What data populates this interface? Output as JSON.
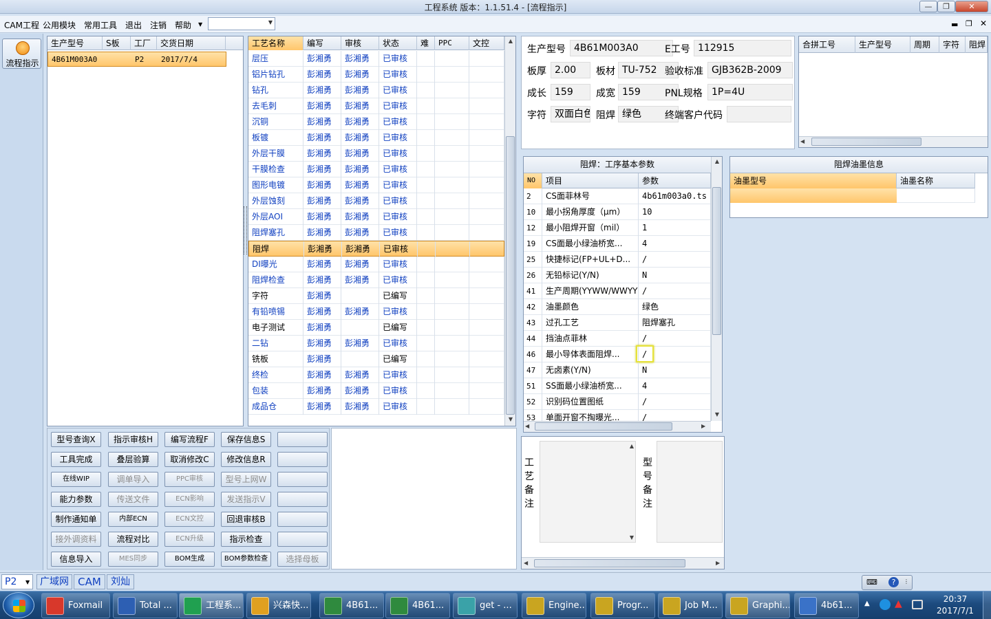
{
  "window": {
    "title": "工程系统   版本：1.1.51.4 - [流程指示]"
  },
  "menu": {
    "items": [
      "CAM工程",
      "公用模块",
      "常用工具",
      "退出",
      "注销",
      "帮助"
    ],
    "combo_value": ""
  },
  "left_strip": {
    "flow_button": "流程指示"
  },
  "orders": {
    "columns": [
      "生产型号",
      "S板",
      "工厂",
      "交货日期"
    ],
    "rows": [
      {
        "model": "4B61M003A0",
        "s": "",
        "factory": "P2",
        "date": "2017/7/4"
      }
    ]
  },
  "process": {
    "columns": [
      "工艺名称",
      "编写",
      "审核",
      "状态",
      "难",
      "PPC",
      "文控"
    ],
    "selected_index": 12,
    "rows": [
      {
        "name": "层压",
        "writer": "彭湘勇",
        "reviewer": "彭湘勇",
        "status": "已审核"
      },
      {
        "name": "铝片钻孔",
        "writer": "彭湘勇",
        "reviewer": "彭湘勇",
        "status": "已审核"
      },
      {
        "name": "钻孔",
        "writer": "彭湘勇",
        "reviewer": "彭湘勇",
        "status": "已审核"
      },
      {
        "name": "去毛刺",
        "writer": "彭湘勇",
        "reviewer": "彭湘勇",
        "status": "已审核"
      },
      {
        "name": "沉铜",
        "writer": "彭湘勇",
        "reviewer": "彭湘勇",
        "status": "已审核"
      },
      {
        "name": "板镀",
        "writer": "彭湘勇",
        "reviewer": "彭湘勇",
        "status": "已审核"
      },
      {
        "name": "外层干膜",
        "writer": "彭湘勇",
        "reviewer": "彭湘勇",
        "status": "已审核"
      },
      {
        "name": "干膜检查",
        "writer": "彭湘勇",
        "reviewer": "彭湘勇",
        "status": "已审核"
      },
      {
        "name": "图形电镀",
        "writer": "彭湘勇",
        "reviewer": "彭湘勇",
        "status": "已审核"
      },
      {
        "name": "外层蚀刻",
        "writer": "彭湘勇",
        "reviewer": "彭湘勇",
        "status": "已审核"
      },
      {
        "name": "外层AOI",
        "writer": "彭湘勇",
        "reviewer": "彭湘勇",
        "status": "已审核"
      },
      {
        "name": "阻焊塞孔",
        "writer": "彭湘勇",
        "reviewer": "彭湘勇",
        "status": "已审核"
      },
      {
        "name": "阻焊",
        "writer": "彭湘勇",
        "reviewer": "彭湘勇",
        "status": "已审核"
      },
      {
        "name": "DI曝光",
        "writer": "彭湘勇",
        "reviewer": "彭湘勇",
        "status": "已审核"
      },
      {
        "name": "阻焊检查",
        "writer": "彭湘勇",
        "reviewer": "彭湘勇",
        "status": "已审核"
      },
      {
        "name": "字符",
        "writer": "彭湘勇",
        "reviewer": "",
        "status": "已编写"
      },
      {
        "name": "有铅喷锡",
        "writer": "彭湘勇",
        "reviewer": "彭湘勇",
        "status": "已审核"
      },
      {
        "name": "电子测试",
        "writer": "彭湘勇",
        "reviewer": "",
        "status": "已编写"
      },
      {
        "name": "二钻",
        "writer": "彭湘勇",
        "reviewer": "彭湘勇",
        "status": "已审核"
      },
      {
        "name": "铣板",
        "writer": "彭湘勇",
        "reviewer": "",
        "status": "已编写"
      },
      {
        "name": "终检",
        "writer": "彭湘勇",
        "reviewer": "彭湘勇",
        "status": "已审核"
      },
      {
        "name": "包装",
        "writer": "彭湘勇",
        "reviewer": "彭湘勇",
        "status": "已审核"
      },
      {
        "name": "成品仓",
        "writer": "彭湘勇",
        "reviewer": "彭湘勇",
        "status": "已审核"
      }
    ]
  },
  "buttons": {
    "rows": [
      [
        {
          "t": "型号查询X",
          "d": false
        },
        {
          "t": "指示审核H",
          "d": false
        },
        {
          "t": "编写流程F",
          "d": false
        },
        {
          "t": "保存信息S",
          "d": false
        },
        {
          "t": "",
          "d": false
        }
      ],
      [
        {
          "t": "工具完成",
          "d": false
        },
        {
          "t": "叠层验算",
          "d": false
        },
        {
          "t": "取消修改C",
          "d": false
        },
        {
          "t": "修改信息R",
          "d": false
        },
        {
          "t": "",
          "d": false
        }
      ],
      [
        {
          "t": "在线WIP",
          "d": false
        },
        {
          "t": "调单导入",
          "d": true
        },
        {
          "t": "PPC审核",
          "d": true
        },
        {
          "t": "型号上网W",
          "d": true
        },
        {
          "t": "",
          "d": false
        }
      ],
      [
        {
          "t": "能力参数",
          "d": false
        },
        {
          "t": "传送文件",
          "d": true
        },
        {
          "t": "ECN影响",
          "d": true
        },
        {
          "t": "发送指示V",
          "d": true
        },
        {
          "t": "",
          "d": false
        }
      ],
      [
        {
          "t": "制作通知单",
          "d": false
        },
        {
          "t": "内部ECN",
          "d": false
        },
        {
          "t": "ECN文控",
          "d": true
        },
        {
          "t": "回退审核B",
          "d": false
        },
        {
          "t": "",
          "d": false
        }
      ],
      [
        {
          "t": "接外调资料",
          "d": true
        },
        {
          "t": "流程对比",
          "d": false
        },
        {
          "t": "ECN升级",
          "d": true
        },
        {
          "t": "指示检查",
          "d": false
        },
        {
          "t": "",
          "d": false
        }
      ],
      [
        {
          "t": "信息导入",
          "d": false
        },
        {
          "t": "MES同步",
          "d": true
        },
        {
          "t": "BOM生成",
          "d": false
        },
        {
          "t": "BOM参数检查",
          "d": false
        },
        {
          "t": "选择母板",
          "d": true
        }
      ]
    ]
  },
  "info": {
    "fields": [
      [
        {
          "label": "生产型号",
          "value": "4B61M003A0"
        },
        {
          "label": "E工号",
          "value": "112915"
        }
      ],
      [
        {
          "label": "板厚",
          "value": "2.00"
        },
        {
          "label": "板材",
          "value": "TU-752"
        },
        {
          "label": "验收标准",
          "value": "GJB362B-2009"
        }
      ],
      [
        {
          "label": "成长",
          "value": "159"
        },
        {
          "label": "成宽",
          "value": "159"
        },
        {
          "label": "PNL规格",
          "value": "1P=4U"
        }
      ],
      [
        {
          "label": "字符",
          "value": "双面白色"
        },
        {
          "label": "阻焊",
          "value": "绿色"
        },
        {
          "label": "终端客户代码",
          "value": ""
        }
      ]
    ]
  },
  "merge": {
    "columns": [
      "合拼工号",
      "生产型号",
      "周期",
      "字符",
      "阻焊"
    ]
  },
  "params": {
    "title": "阻焊：工序基本参数",
    "columns": [
      "NO",
      "项目",
      "参数"
    ],
    "rows": [
      {
        "no": "2",
        "item": "CS面菲林号",
        "val": "4b61m003a0.ts"
      },
      {
        "no": "10",
        "item": "最小拐角厚度（μm）",
        "val": "10"
      },
      {
        "no": "12",
        "item": "最小阻焊开窗（mil）",
        "val": "1"
      },
      {
        "no": "19",
        "item": "CS面最小绿油桥宽...",
        "val": "4"
      },
      {
        "no": "25",
        "item": "快捷标记(FP+UL+D...",
        "val": "/"
      },
      {
        "no": "26",
        "item": "无铅标记(Y/N)",
        "val": "N"
      },
      {
        "no": "41",
        "item": "生产周期(YYWW/WWYY)",
        "val": "/"
      },
      {
        "no": "42",
        "item": "油墨颜色",
        "val": "绿色"
      },
      {
        "no": "43",
        "item": "过孔工艺",
        "val": "阻焊塞孔"
      },
      {
        "no": "44",
        "item": "挡油点菲林",
        "val": "/"
      },
      {
        "no": "46",
        "item": "最小导体表面阻焊...",
        "val": "/"
      },
      {
        "no": "47",
        "item": "无卤素(Y/N)",
        "val": "N"
      },
      {
        "no": "51",
        "item": "SS面最小绿油桥宽...",
        "val": "4"
      },
      {
        "no": "52",
        "item": "识别码位置图纸",
        "val": "/"
      },
      {
        "no": "53",
        "item": "单面开窗不掏曝光...",
        "val": "/"
      }
    ]
  },
  "ink": {
    "title": "阻焊油墨信息",
    "columns": [
      "油墨型号",
      "油墨名称"
    ]
  },
  "remarks": {
    "process_label": "工艺备注",
    "model_label": "型号备注"
  },
  "statusbar": {
    "factory": "P2",
    "items": [
      "广域网",
      "CAM",
      "刘灿"
    ]
  },
  "taskbar": {
    "tasks": [
      {
        "label": "Foxmail",
        "color": "#d8382b"
      },
      {
        "label": "Total ...",
        "color": "#2d5fb3"
      },
      {
        "label": "工程系...",
        "color": "#20a050"
      },
      {
        "label": "兴森快...",
        "color": "#e0a020"
      },
      {
        "label": "4B61...",
        "color": "#2f8a3e"
      },
      {
        "label": "4B61...",
        "color": "#2f8a3e"
      },
      {
        "label": "get - ...",
        "color": "#3aa2a8"
      },
      {
        "label": "Engine...",
        "color": "#c9a520"
      },
      {
        "label": "Progr...",
        "color": "#c9a520"
      },
      {
        "label": "Job M...",
        "color": "#c9a520"
      },
      {
        "label": "Graphi...",
        "color": "#c9a520"
      },
      {
        "label": "4b61...",
        "color": "#3a72c8"
      }
    ],
    "clock_time": "20:37",
    "clock_date": "2017/7/1"
  }
}
